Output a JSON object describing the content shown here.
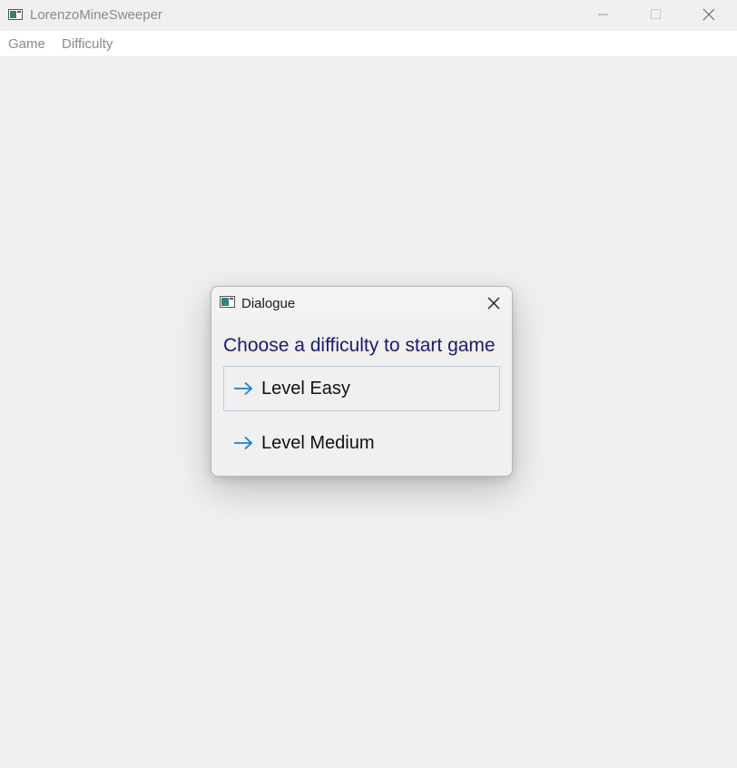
{
  "window": {
    "title": "LorenzoMineSweeper",
    "icon": "app-window-icon",
    "controls": [
      "minimize-icon",
      "maximize-icon",
      "close-icon"
    ]
  },
  "menubar": {
    "items": [
      {
        "label": "Game"
      },
      {
        "label": "Difficulty"
      }
    ]
  },
  "dialog": {
    "title": "Dialogue",
    "icon": "app-window-icon",
    "instruction": "Choose a difficulty to start game",
    "options": [
      {
        "label": "Level Easy",
        "icon": "arrow-right-icon"
      },
      {
        "label": "Level Medium",
        "icon": "arrow-right-icon"
      }
    ]
  },
  "colors": {
    "background": "#f0f0f0",
    "instruction_text": "#1a1a6e",
    "arrow_accent": "#1a7fd1",
    "menu_text": "#8a8a8a"
  }
}
